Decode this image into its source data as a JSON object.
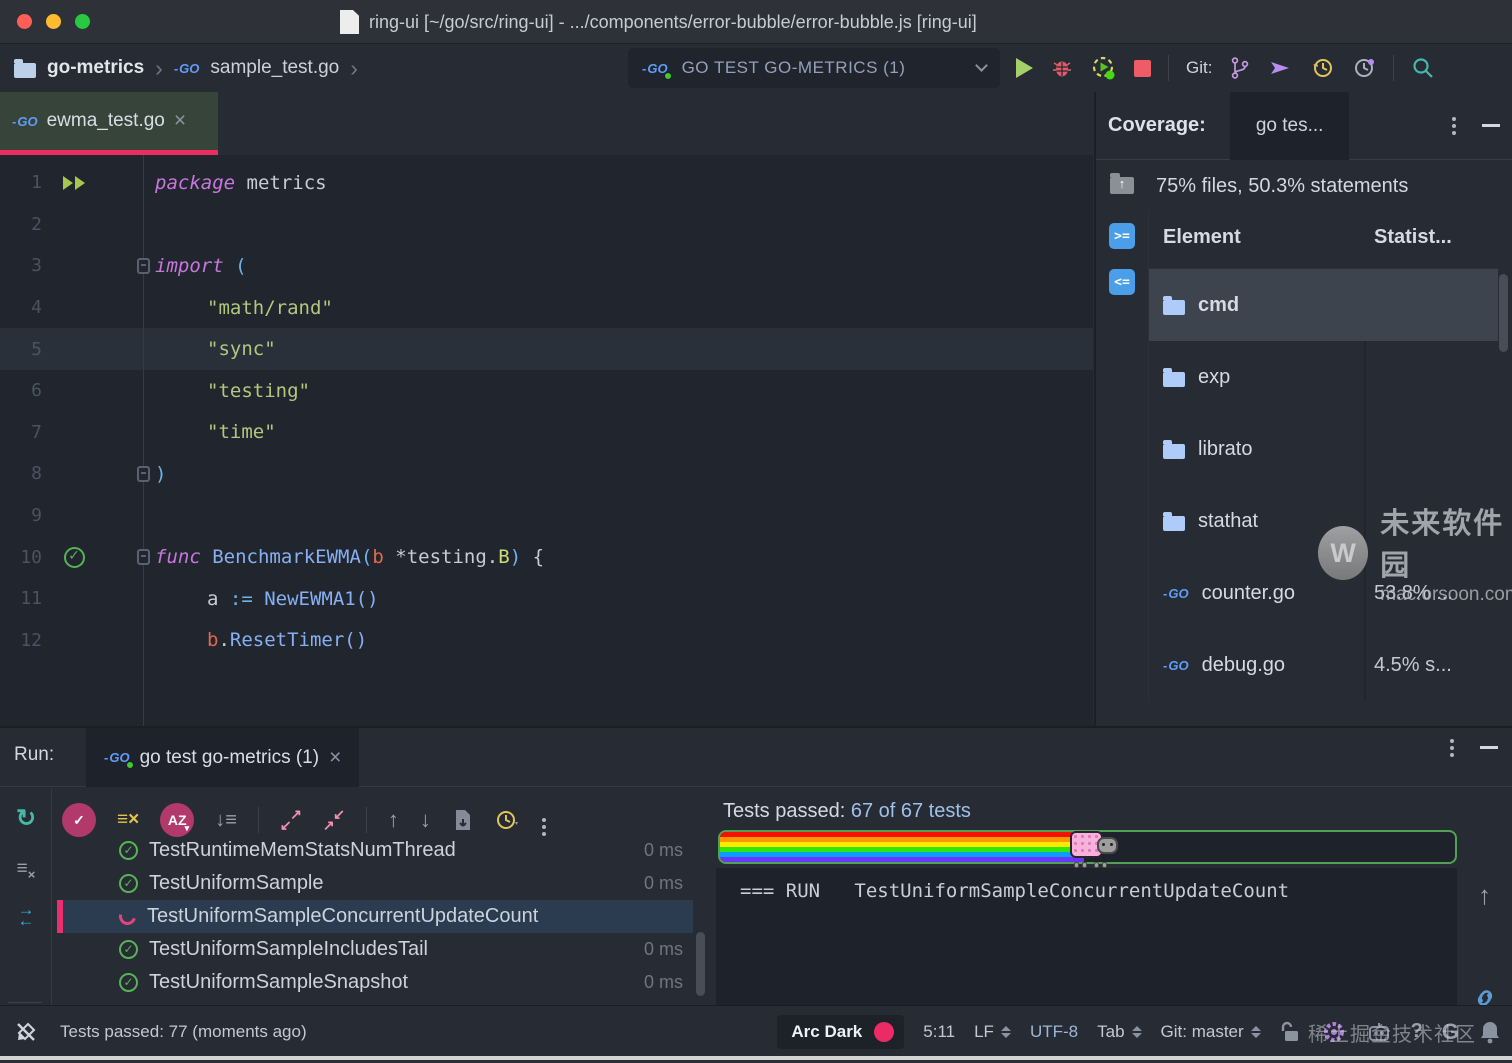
{
  "window": {
    "title": "ring-ui [~/go/src/ring-ui] - .../components/error-bubble/error-bubble.js [ring-ui]"
  },
  "toolbar": {
    "project": "go-metrics",
    "file": "sample_test.go",
    "run_config": "GO TEST GO-METRICS (1)",
    "git_label": "Git:"
  },
  "editor": {
    "tab_label": "ewma_test.go",
    "lines": [
      {
        "num": "1",
        "icon": "run-all",
        "segments": [
          {
            "c": "kw",
            "t": "package"
          },
          {
            "c": "plain",
            "t": " metrics"
          }
        ]
      },
      {
        "num": "2",
        "segments": []
      },
      {
        "num": "3",
        "fold": "open",
        "segments": [
          {
            "c": "kw",
            "t": "import"
          },
          {
            "c": "plain",
            "t": " "
          },
          {
            "c": "paren",
            "t": "("
          }
        ]
      },
      {
        "num": "4",
        "indent": 1,
        "segments": [
          {
            "c": "str",
            "t": "\"math/rand\""
          }
        ]
      },
      {
        "num": "5",
        "indent": 1,
        "caret": true,
        "segments": [
          {
            "c": "str",
            "t": "\"sync\""
          }
        ]
      },
      {
        "num": "6",
        "indent": 1,
        "segments": [
          {
            "c": "str",
            "t": "\"testing\""
          }
        ]
      },
      {
        "num": "7",
        "indent": 1,
        "segments": [
          {
            "c": "str",
            "t": "\"time\""
          }
        ]
      },
      {
        "num": "8",
        "fold": "close",
        "segments": [
          {
            "c": "paren",
            "t": ")"
          }
        ]
      },
      {
        "num": "9",
        "segments": []
      },
      {
        "num": "10",
        "icon": "check",
        "fold": "open",
        "segments": [
          {
            "c": "kw",
            "t": "func"
          },
          {
            "c": "plain",
            "t": " "
          },
          {
            "c": "fn",
            "t": "BenchmarkEWMA"
          },
          {
            "c": "paren",
            "t": "("
          },
          {
            "c": "param",
            "t": "b"
          },
          {
            "c": "plain",
            "t": " *testing."
          },
          {
            "c": "type",
            "t": "B"
          },
          {
            "c": "paren",
            "t": ")"
          },
          {
            "c": "plain",
            "t": " {"
          }
        ]
      },
      {
        "num": "11",
        "indent": 1,
        "segments": [
          {
            "c": "plain",
            "t": "a "
          },
          {
            "c": "op",
            "t": ":="
          },
          {
            "c": "plain",
            "t": " "
          },
          {
            "c": "fn",
            "t": "NewEWMA1()"
          }
        ]
      },
      {
        "num": "12",
        "indent": 1,
        "segments": [
          {
            "c": "param",
            "t": "b"
          },
          {
            "c": "plain",
            "t": "."
          },
          {
            "c": "fn",
            "t": "ResetTimer()"
          }
        ]
      }
    ]
  },
  "coverage": {
    "panel_label": "Coverage:",
    "tab_label": "go tes...",
    "summary": "75% files, 50.3% statements",
    "col_element": "Element",
    "col_statistics": "Statist...",
    "rows": [
      {
        "icon": "folder",
        "name": "cmd",
        "stat": "",
        "selected": true
      },
      {
        "icon": "folder",
        "name": "exp",
        "stat": ""
      },
      {
        "icon": "folder",
        "name": "librato",
        "stat": ""
      },
      {
        "icon": "folder",
        "name": "stathat",
        "stat": ""
      },
      {
        "icon": "go-file",
        "name": "counter.go",
        "stat": "53.8% ..."
      },
      {
        "icon": "go-file",
        "name": "debug.go",
        "stat": "4.5% s..."
      }
    ]
  },
  "run_panel": {
    "panel_label": "Run:",
    "tab_label": "go test go-metrics (1)",
    "tests": [
      {
        "status": "passed",
        "name": "TestRuntimeMemStatsNumThread",
        "time": "0 ms"
      },
      {
        "status": "passed",
        "name": "TestUniformSample",
        "time": "0 ms"
      },
      {
        "status": "running",
        "name": "TestUniformSampleConcurrentUpdateCount",
        "time": "",
        "selected": true
      },
      {
        "status": "passed",
        "name": "TestUniformSampleIncludesTail",
        "time": "0 ms"
      },
      {
        "status": "passed",
        "name": "TestUniformSampleSnapshot",
        "time": "0 ms"
      }
    ],
    "summary_prefix": "Tests passed: ",
    "summary_value": "67 of 67 tests",
    "progress_pct": 49.5,
    "console_line": "=== RUN   TestUniformSampleConcurrentUpdateCount"
  },
  "status_bar": {
    "message": "Tests passed: 77 (moments ago)",
    "theme_name": "Arc Dark",
    "caret_position": "5:11",
    "line_separator": "LF",
    "encoding": "UTF-8",
    "indent_style": "Tab",
    "git_branch": "Git: master"
  },
  "watermarks": {
    "site_logo_letter": "W",
    "site_name": "未来软件园",
    "site_url": "mac.orsoon.com",
    "community": "稀土掘金技术社区"
  },
  "colors": {
    "accent_pink": "#ec2d5f",
    "go_blue": "#5f9df8",
    "pass_green": "#57b356",
    "selected_row_blue": "#2b3b50"
  }
}
